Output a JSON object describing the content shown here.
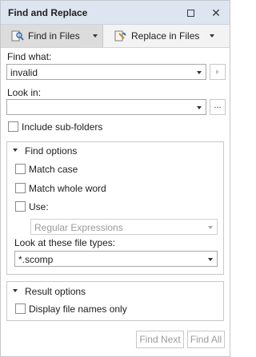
{
  "window": {
    "title": "Find and Replace"
  },
  "tabs": [
    {
      "label": "Find in Files",
      "icon": "find-in-files-icon",
      "active": true
    },
    {
      "label": "Replace in Files",
      "icon": "replace-in-files-icon",
      "active": false
    }
  ],
  "find_what": {
    "label": "Find what:",
    "value": "invalid"
  },
  "look_in": {
    "label": "Look in:",
    "value": "",
    "browse_label": "..."
  },
  "include_subfolders": {
    "label": "Include sub-folders",
    "checked": false
  },
  "find_options": {
    "header": "Find options",
    "match_case": {
      "label": "Match case",
      "checked": false
    },
    "match_whole_word": {
      "label": "Match whole word",
      "checked": false
    },
    "use": {
      "label": "Use:",
      "checked": false
    },
    "use_mode": {
      "value": "Regular Expressions",
      "enabled": false
    },
    "file_types_label": "Look at these file types:",
    "file_types_value": "*.scomp"
  },
  "result_options": {
    "header": "Result options",
    "display_file_names_only": {
      "label": "Display file names only",
      "checked": false
    }
  },
  "buttons": {
    "find_next": "Find Next",
    "find_all": "Find All"
  },
  "colors": {
    "titlebar_bg": "#dde5f1",
    "active_tab_bg": "#dcdcdc",
    "disabled_text": "#9a9a9a"
  }
}
